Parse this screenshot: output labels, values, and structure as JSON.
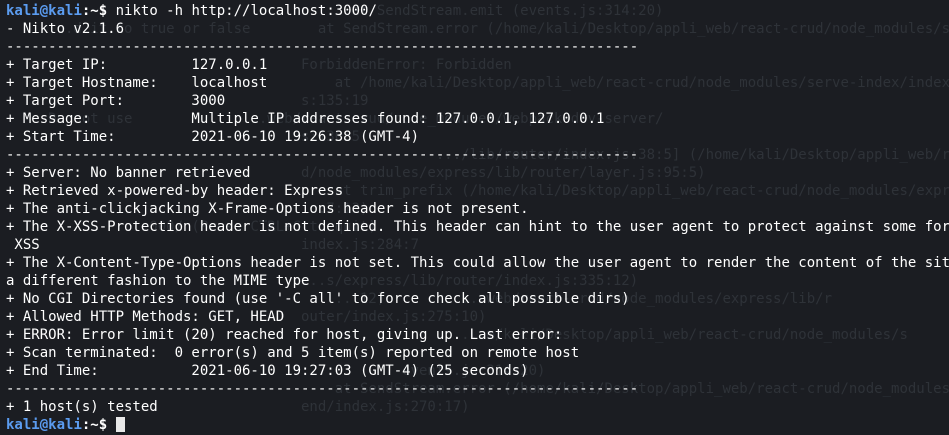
{
  "prompt": {
    "user": "kali",
    "at": "@",
    "host": "kali",
    "path": ":~$"
  },
  "command": "nikto -h http://localhost:3000/",
  "output_lines": [
    "- Nikto v2.1.6",
    "---------------------------------------------------------------------------",
    "+ Target IP:          127.0.0.1",
    "+ Target Hostname:    localhost",
    "+ Target Port:        3000",
    "+ Message:            Multiple IP addresses found: 127.0.0.1, 127.0.0.1",
    "+ Start Time:         2021-06-10 19:26:38 (GMT-4)",
    "---------------------------------------------------------------------------",
    "+ Server: No banner retrieved",
    "+ Retrieved x-powered-by header: Express",
    "+ The anti-clickjacking X-Frame-Options header is not present.",
    "+ The X-XSS-Protection header is not defined. This header can hint to the user agent to protect against some forms of",
    " XSS",
    "+ The X-Content-Type-Options header is not set. This could allow the user agent to render the content of the site in",
    "a different fashion to the MIME type",
    "+ No CGI Directories found (use '-C all' to force check all possible dirs)",
    "+ Allowed HTTP Methods: GET, HEAD",
    "+ ERROR: Error limit (20) reached for host, giving up. Last error:",
    "+ Scan terminated:  0 error(s) and 5 item(s) reported on remote host",
    "+ End Time:           2021-06-10 19:27:03 (GMT-4) (25 seconds)",
    "---------------------------------------------------------------------------",
    "+ 1 host(s) tested"
  ],
  "background_ghost_lines": [
    "                                         at SendStream.emit (events.js:314:20)",
    "     ...d it to true or false        at SendStream.error (/home/kali/Desktop/appli_web/react-crud/node_modules/s",
    "",
    "                                   ForbiddenError: Forbidden",
    "                                       at /home/kali/Desktop/appli_web/react-crud/node_modules/serve-index/index.",
    "                                   s:135:19",
    "     Do not use             ...web/react-crud/node_modules/webpack-dev-server/",
    "                                   s:130:5",
    "                                                   .../lib/router/index.js:38:5] (/home/kali/Desktop/appli_web/react-cru",
    "                                   d/node_modules/express/lib/router/layer.js:95:5)",
    "                                       at trim_prefix (/home/kali/Desktop/appli_web/react-crud/node_modules/express/",
    "                                   ...7:13)",
    "              ...000/ (Press CTRL+C to quit)",
    "                                   index.js:284:7",
    "",
    "                                   ...s/express/lib/router/index.js:335:12)",
    "                                       ...12)         ...web/react-crud/node_modules/express/lib/r",
    "                                   outer/index.js:275:10)",
    "                                                      ...m/kali/Desktop/appli_web/react-crud/node_modules/s",
    "",
    "                                   ...         events.js:314:20)",
    "                                       at SendStream.error (/home/kali/Desktop/appli_web/react-crud/node_modules/s",
    "                                   end/index.js:270:17)",
    ""
  ]
}
